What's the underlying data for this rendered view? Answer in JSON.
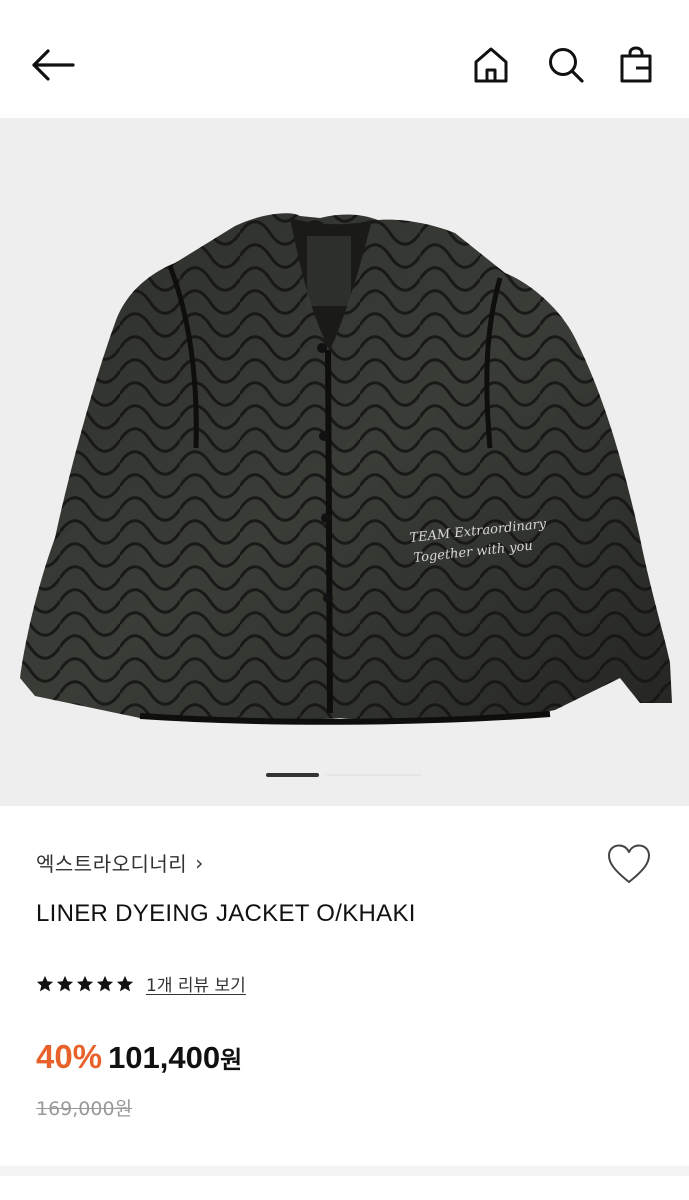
{
  "header": {
    "back_icon": "arrow-left-icon",
    "home_icon": "home-icon",
    "search_icon": "search-icon",
    "cart_icon": "shopping-bag-icon"
  },
  "gallery": {
    "image_subject": "quilted liner jacket",
    "print_line1": "TEAM Extraordinary",
    "print_line2": "Together with you",
    "active_slide": 1
  },
  "product": {
    "brand": "엑스트라오디너리",
    "brand_chevron": "›",
    "title": "LINER DYEING JACKET O/KHAKI",
    "rating": 5,
    "rating_max": 5,
    "review_link": "1개 리뷰 보기",
    "discount": "40%",
    "price": "101,400",
    "price_unit": "원",
    "original_price": "169,000원"
  },
  "colors": {
    "accent": "#e8612a",
    "text": "#111111",
    "muted": "#999999",
    "gallery_bg": "#eeeeee"
  }
}
